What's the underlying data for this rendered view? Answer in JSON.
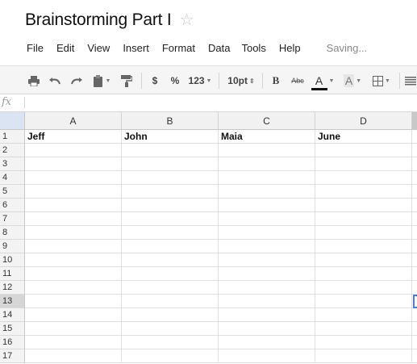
{
  "document": {
    "title": "Brainstorming Part I",
    "star_glyph": "☆"
  },
  "menu": {
    "items": [
      "File",
      "Edit",
      "View",
      "Insert",
      "Format",
      "Data",
      "Tools",
      "Help"
    ],
    "status": "Saving..."
  },
  "toolbar": {
    "currency": "$",
    "percent": "%",
    "number_format": "123",
    "font_size": "10pt",
    "bold": "B",
    "strikethrough": "Abc",
    "text_color": "A",
    "fill_color": "A"
  },
  "formula_bar": {
    "label": "fx",
    "value": ""
  },
  "sheet": {
    "columns": [
      "A",
      "B",
      "C",
      "D"
    ],
    "rows": [
      "1",
      "2",
      "3",
      "4",
      "5",
      "6",
      "7",
      "8",
      "9",
      "10",
      "11",
      "12",
      "13",
      "14",
      "15",
      "16",
      "17"
    ],
    "row1": [
      "Jeff",
      "John",
      "Maia",
      "June"
    ],
    "selected_row": "13"
  },
  "colors": {
    "selection": "#4a7ee6",
    "toolbar_bg": "#f5f5f5"
  }
}
